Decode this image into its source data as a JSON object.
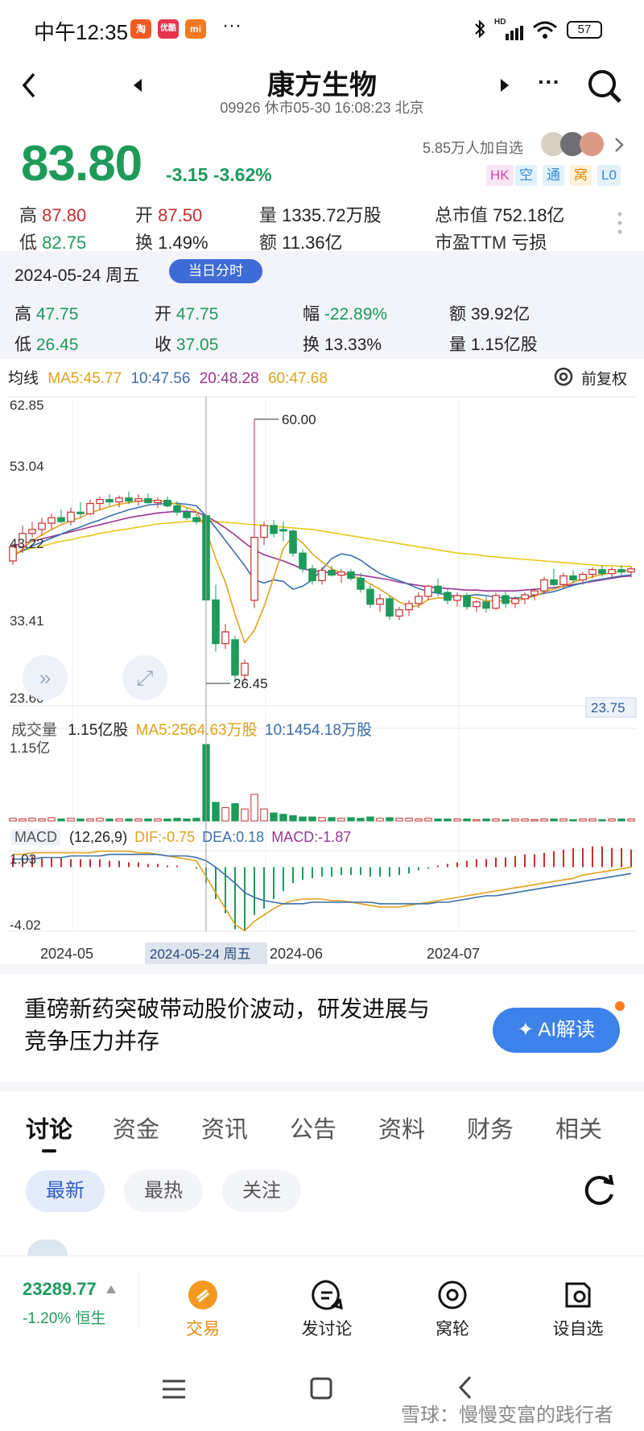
{
  "status_bar": {
    "time": "中午12:35",
    "apps": [
      "淘",
      "优酷",
      "mi"
    ],
    "more": "···",
    "network": "HD",
    "battery": "57"
  },
  "header": {
    "title": "康方生物",
    "subtitle": "09926 休市05-30 16:08:23 北京",
    "more": "···"
  },
  "quote": {
    "price": "83.80",
    "change": "-3.15 -3.62%",
    "watchers": "5.85万人加自选",
    "tags": [
      "HK",
      "空",
      "通",
      "窝",
      "L0"
    ],
    "stats": [
      {
        "k": "高",
        "v": "87.80"
      },
      {
        "k": "开",
        "v": "87.50"
      },
      {
        "k": "量",
        "v": "1335.72万股"
      },
      {
        "k": "总市值",
        "v": "752.18亿"
      },
      {
        "k": "低",
        "v": "82.75"
      },
      {
        "k": "换",
        "v": "1.49%"
      },
      {
        "k": "额",
        "v": "11.36亿"
      },
      {
        "k": "市盈TTM",
        "v": "亏损"
      }
    ]
  },
  "day_detail": {
    "date": "2024-05-24 周五",
    "button": "当日分时",
    "stats": [
      {
        "k": "高",
        "v": "47.75"
      },
      {
        "k": "开",
        "v": "47.75"
      },
      {
        "k": "幅",
        "v": "-22.89%"
      },
      {
        "k": "额",
        "v": "39.92亿"
      },
      {
        "k": "低",
        "v": "26.45"
      },
      {
        "k": "收",
        "v": "37.05"
      },
      {
        "k": "换",
        "v": "13.33%"
      },
      {
        "k": "量",
        "v": "1.15亿股"
      }
    ]
  },
  "ma_legend": {
    "label": "均线",
    "ma5": "MA5:45.77",
    "ma10": "10:47.56",
    "ma20": "20:48.28",
    "ma60": "60:47.68",
    "adjust": "前复权"
  },
  "volume_legend": {
    "label": "成交量",
    "value": "1.15亿股",
    "ma5": "MA5:2564.63万股",
    "ma10": "10:1454.18万股"
  },
  "macd_legend": {
    "label": "MACD",
    "params": "(12,26,9)",
    "dif": "DIF:-0.75",
    "dea": "DEA:0.18",
    "macd": "MACD:-1.87"
  },
  "chart_data": {
    "type": "candlestick",
    "y_ticks": [
      "62.85",
      "53.04",
      "43.22",
      "33.41",
      "23.60"
    ],
    "ylim": [
      23.6,
      62.85
    ],
    "x_labels": [
      "2024-05",
      "2024-06",
      "2024-07"
    ],
    "crosshair_date": "2024-05-24 周五",
    "high_label": "60.00",
    "low_label": "26.45",
    "last_price_label": "23.75",
    "vol_top_label": "1.15亿",
    "macd_ticks": [
      "1.03",
      "-4.02"
    ],
    "ohlc": [
      [
        42.0,
        44.2,
        41.5,
        43.8
      ],
      [
        43.8,
        46.5,
        43.0,
        45.5
      ],
      [
        45.5,
        47.0,
        45.0,
        46.0
      ],
      [
        46.0,
        47.5,
        45.2,
        46.8
      ],
      [
        46.8,
        48.0,
        46.0,
        47.5
      ],
      [
        47.5,
        48.5,
        46.8,
        47.0
      ],
      [
        47.0,
        48.8,
        46.5,
        48.2
      ],
      [
        48.2,
        49.5,
        47.5,
        48.0
      ],
      [
        48.0,
        49.8,
        47.8,
        49.3
      ],
      [
        49.3,
        50.2,
        48.5,
        49.8
      ],
      [
        49.8,
        50.5,
        49.0,
        49.5
      ],
      [
        49.5,
        50.3,
        48.8,
        50.0
      ],
      [
        50.0,
        50.8,
        49.2,
        49.6
      ],
      [
        49.6,
        50.5,
        49.0,
        49.9
      ],
      [
        49.9,
        50.6,
        49.3,
        49.4
      ],
      [
        49.4,
        50.1,
        48.7,
        49.7
      ],
      [
        49.7,
        50.2,
        48.8,
        49.0
      ],
      [
        49.0,
        49.6,
        47.8,
        48.2
      ],
      [
        48.2,
        48.7,
        47.2,
        47.5
      ],
      [
        47.5,
        48.0,
        46.6,
        47.0
      ],
      [
        47.75,
        47.75,
        26.45,
        37.05
      ],
      [
        37.05,
        39.0,
        30.5,
        31.5
      ],
      [
        31.5,
        34.0,
        30.8,
        33.0
      ],
      [
        32.0,
        32.5,
        26.5,
        27.5
      ],
      [
        27.5,
        29.5,
        26.8,
        29.0
      ],
      [
        37.0,
        60.0,
        36.0,
        45.0
      ],
      [
        45.0,
        47.0,
        44.0,
        46.5
      ],
      [
        46.5,
        47.2,
        45.0,
        45.5
      ],
      [
        46.0,
        47.0,
        44.5,
        45.8
      ],
      [
        45.8,
        46.0,
        42.5,
        43.0
      ],
      [
        43.0,
        43.5,
        40.5,
        41.0
      ],
      [
        41.0,
        41.5,
        39.0,
        39.5
      ],
      [
        39.5,
        41.2,
        39.0,
        40.8
      ],
      [
        40.8,
        41.4,
        40.0,
        40.2
      ],
      [
        40.2,
        41.0,
        39.2,
        40.6
      ],
      [
        40.6,
        41.0,
        39.5,
        39.8
      ],
      [
        39.8,
        40.5,
        38.0,
        38.4
      ],
      [
        38.4,
        39.0,
        36.0,
        36.5
      ],
      [
        36.5,
        37.8,
        35.5,
        37.2
      ],
      [
        37.2,
        37.6,
        34.5,
        35.0
      ],
      [
        35.0,
        36.2,
        34.5,
        35.8
      ],
      [
        35.8,
        37.0,
        35.0,
        36.6
      ],
      [
        36.6,
        38.0,
        36.0,
        37.5
      ],
      [
        37.5,
        39.0,
        37.0,
        38.8
      ],
      [
        38.8,
        39.8,
        37.5,
        38.0
      ],
      [
        38.0,
        38.5,
        36.5,
        37.0
      ],
      [
        37.0,
        38.0,
        36.2,
        37.6
      ],
      [
        37.6,
        38.0,
        35.8,
        36.2
      ],
      [
        36.2,
        37.0,
        35.5,
        36.8
      ],
      [
        36.8,
        37.5,
        35.4,
        36.0
      ],
      [
        36.0,
        38.0,
        35.8,
        37.6
      ],
      [
        37.6,
        38.2,
        36.0,
        36.6
      ],
      [
        36.6,
        37.5,
        36.0,
        37.2
      ],
      [
        37.2,
        38.0,
        36.5,
        37.7
      ],
      [
        37.7,
        38.5,
        37.0,
        38.2
      ],
      [
        38.2,
        40.0,
        37.8,
        39.6
      ],
      [
        39.6,
        41.0,
        38.8,
        39.0
      ],
      [
        39.0,
        40.5,
        38.5,
        40.1
      ],
      [
        40.1,
        40.8,
        39.2,
        39.6
      ],
      [
        39.6,
        40.6,
        39.0,
        40.3
      ],
      [
        40.3,
        41.2,
        39.8,
        40.9
      ],
      [
        40.9,
        41.5,
        40.0,
        40.4
      ],
      [
        40.4,
        41.2,
        39.8,
        40.9
      ],
      [
        40.9,
        41.5,
        40.2,
        40.6
      ],
      [
        40.6,
        41.3,
        39.9,
        41.0
      ]
    ],
    "ma5": [
      42.5,
      43.5,
      44.6,
      45.3,
      46.0,
      46.6,
      47.1,
      47.5,
      48.1,
      48.5,
      48.9,
      49.2,
      49.4,
      49.6,
      49.7,
      49.6,
      49.5,
      49.2,
      48.8,
      48.3,
      45.9,
      42.3,
      39.3,
      35.2,
      31.6,
      33.2,
      36.2,
      39.9,
      43.6,
      45.2,
      44.3,
      42.9,
      41.9,
      41.0,
      40.5,
      40.1,
      39.8,
      39.1,
      38.4,
      37.6,
      36.8,
      36.2,
      36.3,
      37.1,
      37.3,
      37.3,
      37.5,
      37.5,
      37.3,
      36.9,
      37.0,
      36.9,
      36.9,
      37.2,
      37.5,
      38.1,
      38.4,
      38.8,
      39.3,
      39.7,
      40.0,
      40.3,
      40.5,
      40.7,
      40.8
    ],
    "ma10": [
      42.7,
      43.3,
      43.9,
      44.4,
      44.9,
      45.4,
      45.9,
      46.3,
      46.8,
      47.2,
      47.7,
      48.1,
      48.5,
      48.8,
      49.1,
      49.2,
      49.3,
      49.3,
      49.2,
      49.0,
      47.7,
      46.2,
      44.6,
      43.0,
      41.4,
      39.6,
      39.2,
      39.6,
      39.4,
      38.4,
      38.8,
      39.6,
      40.9,
      42.3,
      42.9,
      42.7,
      42.1,
      41.2,
      40.4,
      39.9,
      39.5,
      39.0,
      38.5,
      38.1,
      37.9,
      37.7,
      37.5,
      37.6,
      37.7,
      37.6,
      37.4,
      37.3,
      37.3,
      37.4,
      37.6,
      37.9,
      38.1,
      38.5,
      38.9,
      39.2,
      39.5,
      39.7,
      39.9,
      40.1,
      40.2
    ],
    "ma20": [
      44.0,
      44.2,
      44.5,
      44.8,
      45.1,
      45.4,
      45.7,
      46.0,
      46.3,
      46.6,
      46.9,
      47.2,
      47.5,
      47.7,
      47.9,
      48.1,
      48.2,
      48.3,
      48.3,
      48.2,
      47.7,
      47.0,
      46.2,
      45.3,
      44.3,
      43.4,
      42.8,
      42.4,
      42.0,
      41.5,
      41.0,
      40.8,
      40.6,
      40.5,
      40.4,
      40.3,
      40.2,
      40.0,
      39.8,
      39.6,
      39.3,
      39.1,
      38.9,
      38.7,
      38.6,
      38.5,
      38.4,
      38.3,
      38.3,
      38.2,
      38.2,
      38.2,
      38.2,
      38.3,
      38.4,
      38.5,
      38.6,
      38.8,
      39.0,
      39.2,
      39.4,
      39.6,
      39.8,
      40.0,
      40.1
    ],
    "ma60": [
      43.0,
      43.3,
      43.6,
      43.9,
      44.2,
      44.5,
      44.7,
      45.0,
      45.2,
      45.5,
      45.7,
      45.9,
      46.1,
      46.3,
      46.5,
      46.7,
      46.8,
      46.9,
      47.0,
      47.1,
      47.1,
      47.0,
      46.9,
      46.8,
      46.7,
      46.6,
      46.5,
      46.4,
      46.3,
      46.2,
      46.1,
      46.0,
      45.8,
      45.6,
      45.4,
      45.2,
      45.0,
      44.8,
      44.6,
      44.4,
      44.2,
      44.0,
      43.8,
      43.6,
      43.4,
      43.2,
      43.0,
      42.9,
      42.8,
      42.6,
      42.5,
      42.4,
      42.3,
      42.2,
      42.1,
      42.0,
      41.9,
      41.8,
      41.7,
      41.6,
      41.5,
      41.4,
      41.4,
      41.3,
      41.3
    ],
    "volume": [
      4,
      3,
      4,
      3,
      5,
      3,
      4,
      3,
      3,
      4,
      3,
      3,
      3,
      3,
      3,
      3,
      3,
      4,
      3,
      4,
      115,
      28,
      20,
      26,
      18,
      40,
      18,
      12,
      10,
      8,
      6,
      6,
      5,
      5,
      4,
      5,
      4,
      6,
      4,
      5,
      4,
      4,
      3,
      4,
      3,
      3,
      3,
      3,
      2,
      3,
      3,
      2,
      3,
      3,
      2,
      3,
      3,
      3,
      2,
      3,
      3,
      2,
      3,
      3,
      3
    ],
    "macd_hist": [
      0.6,
      0.6,
      0.7,
      0.6,
      0.6,
      0.6,
      0.5,
      0.5,
      0.5,
      0.5,
      0.4,
      0.4,
      0.3,
      0.3,
      0.2,
      0.2,
      0.1,
      0.1,
      0.0,
      -0.1,
      -1.0,
      -2.0,
      -2.9,
      -3.9,
      -4.0,
      -3.0,
      -2.6,
      -2.0,
      -1.5,
      -1.0,
      -0.8,
      -0.7,
      -0.6,
      -0.6,
      -0.5,
      -0.5,
      -0.5,
      -0.6,
      -0.6,
      -0.6,
      -0.5,
      -0.4,
      -0.2,
      -0.1,
      0.1,
      0.2,
      0.3,
      0.4,
      0.5,
      0.5,
      0.6,
      0.6,
      0.7,
      0.8,
      0.8,
      0.9,
      1.0,
      1.1,
      1.2,
      1.2,
      1.3,
      1.3,
      1.2,
      1.2,
      1.1
    ],
    "dif": [
      0.8,
      0.8,
      0.9,
      0.9,
      0.9,
      0.9,
      0.9,
      0.9,
      0.9,
      1.0,
      1.0,
      1.0,
      1.0,
      0.9,
      0.9,
      0.8,
      0.7,
      0.6,
      0.5,
      0.4,
      -0.6,
      -1.6,
      -2.6,
      -3.6,
      -4.0,
      -3.4,
      -3.0,
      -2.6,
      -2.3,
      -2.1,
      -2.0,
      -2.0,
      -2.0,
      -2.1,
      -2.1,
      -2.2,
      -2.3,
      -2.4,
      -2.5,
      -2.5,
      -2.5,
      -2.4,
      -2.3,
      -2.2,
      -2.1,
      -2.0,
      -1.9,
      -1.8,
      -1.7,
      -1.6,
      -1.5,
      -1.4,
      -1.3,
      -1.2,
      -1.1,
      -1.0,
      -0.9,
      -0.8,
      -0.7,
      -0.5,
      -0.4,
      -0.3,
      -0.2,
      -0.1,
      0.0
    ],
    "dea": [
      0.5,
      0.5,
      0.5,
      0.6,
      0.6,
      0.6,
      0.7,
      0.7,
      0.7,
      0.7,
      0.8,
      0.8,
      0.8,
      0.8,
      0.8,
      0.8,
      0.7,
      0.7,
      0.7,
      0.6,
      0.4,
      0.0,
      -0.5,
      -1.0,
      -1.6,
      -1.9,
      -2.1,
      -2.2,
      -2.3,
      -2.3,
      -2.3,
      -2.2,
      -2.2,
      -2.2,
      -2.2,
      -2.2,
      -2.2,
      -2.2,
      -2.3,
      -2.3,
      -2.3,
      -2.3,
      -2.3,
      -2.3,
      -2.2,
      -2.2,
      -2.1,
      -2.0,
      -1.9,
      -1.8,
      -1.8,
      -1.7,
      -1.6,
      -1.5,
      -1.4,
      -1.3,
      -1.2,
      -1.1,
      -1.0,
      -0.9,
      -0.8,
      -0.7,
      -0.6,
      -0.5,
      -0.4
    ]
  },
  "news": {
    "headline": "重磅新药突破带动股价波动，研发进展与竞争压力并存",
    "ai_button": "AI解读"
  },
  "tabs": [
    "讨论",
    "资金",
    "资讯",
    "公告",
    "资料",
    "财务",
    "相关"
  ],
  "filters": [
    "最新",
    "最热",
    "关注"
  ],
  "bottom_bar": {
    "index_value": "23289.77",
    "index_change": "-1.20% 恒生",
    "items": [
      "交易",
      "发讨论",
      "窝轮",
      "设自选"
    ]
  },
  "watermark": "雪球：慢慢变富的践行者",
  "colors": {
    "up": "#c62f2f",
    "down": "#1e9a5b",
    "ma5": "#e2a21f",
    "ma10": "#3a6ea8",
    "ma20": "#9a3592",
    "ma60": "#e6c81a",
    "accent": "#3e6bd6"
  }
}
